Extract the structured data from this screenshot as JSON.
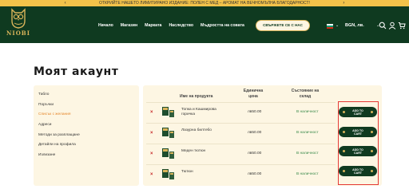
{
  "promo": {
    "text": "ОТКРИЙТЕ НАШЕТО ЛИМИТИРАНО ИЗДАНИЕ: ПОЛЕН С МЕД – АРОМАТ НА ВЕЧНОМЪЛНА БЛАГОДАРНОСТ!",
    "prev_icon": "chevron-left",
    "next_icon": "chevron-right"
  },
  "header": {
    "logo_text": "NIOBI",
    "nav": [
      "Начало",
      "Магазин",
      "Марката",
      "Наследство",
      "Мъдростта на совата"
    ],
    "contact_label": "СВЪРЖЕТЕ СЕ С НАС",
    "currency": "BGN, лв.",
    "icons": [
      "search-icon",
      "user-icon",
      "cart-icon"
    ],
    "colors": {
      "bg": "#0f3a20",
      "accent": "#d9b45a"
    }
  },
  "page": {
    "title": "Моят акаунт"
  },
  "sidebar": {
    "items": [
      {
        "label": "Табло",
        "active": false
      },
      {
        "label": "Поръчки",
        "active": false
      },
      {
        "label": "Списък с желания",
        "active": true
      },
      {
        "label": "Адреси",
        "active": false
      },
      {
        "label": "Методи за разплащане",
        "active": false
      },
      {
        "label": "Детайли на профила",
        "active": false
      },
      {
        "label": "Излизане",
        "active": false
      }
    ]
  },
  "wishlist": {
    "headers": {
      "name": "Име на продукта",
      "unit_price": "Единична цена",
      "status": "Състояние на склад"
    },
    "rows": [
      {
        "name": "Топка и Кашмирова горичка",
        "price": "лв50.00",
        "stock": "В наличност",
        "cart_label": "ADD TO CART"
      },
      {
        "name": "Лазурна билтебо",
        "price": "лв50.00",
        "stock": "В наличност",
        "cart_label": "ADD TO CART"
      },
      {
        "name": "Меден тютюн",
        "price": "лв50.00",
        "stock": "В наличност",
        "cart_label": "ADD TO CART"
      },
      {
        "name": "Тютюн",
        "price": "лв50.00",
        "stock": "В наличност",
        "cart_label": "ADD TO CART"
      }
    ]
  }
}
